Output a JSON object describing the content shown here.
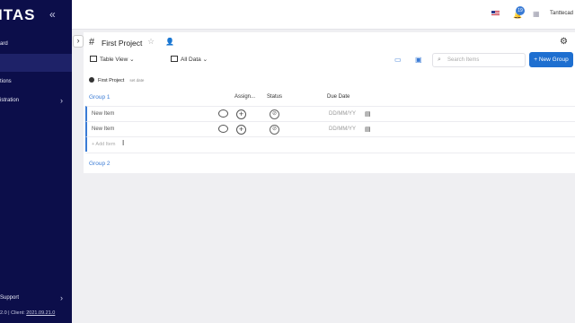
{
  "sidebar": {
    "logo": "ITAS",
    "collapse_glyph": "«",
    "items": [
      {
        "label": "ard",
        "chevron": ""
      },
      {
        "label": "",
        "chevron": ""
      },
      {
        "label": "tions",
        "chevron": ""
      },
      {
        "label": "istration",
        "chevron": "›"
      }
    ],
    "support": {
      "label": "Support",
      "chevron": "›"
    },
    "version_prefix": "2.0 | Client: ",
    "version_link": "2021.09.21.0",
    "colors": {
      "background": "#0c0e4a",
      "active": "#1e2268"
    }
  },
  "topbar": {
    "notification_count": "19",
    "user": "Tanttecad"
  },
  "project": {
    "title": "First Project",
    "view_label": "Table View",
    "data_label": "All Data",
    "search_placeholder": "Search Items",
    "new_group_label": "+ New Group",
    "project_line_label": "First Project",
    "project_line_sub": "set date"
  },
  "table": {
    "columns": [
      "Assign...",
      "Status",
      "Due Date"
    ],
    "group1": {
      "name": "Group 1",
      "rows": [
        {
          "name": "New Item",
          "due": "DD/MM/YY"
        },
        {
          "name": "New Item",
          "due": "DD/MM/YY"
        }
      ],
      "add_item": "+ Add Item"
    },
    "group2": {
      "name": "Group 2"
    }
  },
  "icons": {
    "star": "star-icon",
    "add_user": "add-user-icon",
    "robot": "robot-icon",
    "search": "search-icon",
    "calendar": "calendar-icon",
    "comment": "comment-icon",
    "bell": "bell-icon"
  },
  "accent": "#1e6fd0"
}
